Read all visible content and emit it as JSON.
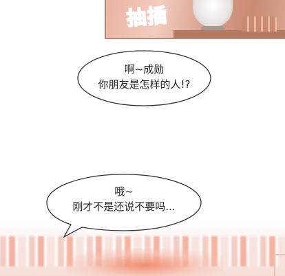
{
  "panel_top": {
    "sfx_text": "抽插"
  },
  "dialogue": [
    {
      "lines": [
        "啊~成勋",
        "你朋友是怎样的人!?"
      ]
    },
    {
      "lines": [
        "哦~",
        "刚才不是还说不要吗..."
      ]
    }
  ],
  "colors": {
    "sfx": "#f04f8c",
    "bubble_outline": "#333333",
    "text": "#222222",
    "panel_warm": "#d9a38d"
  }
}
